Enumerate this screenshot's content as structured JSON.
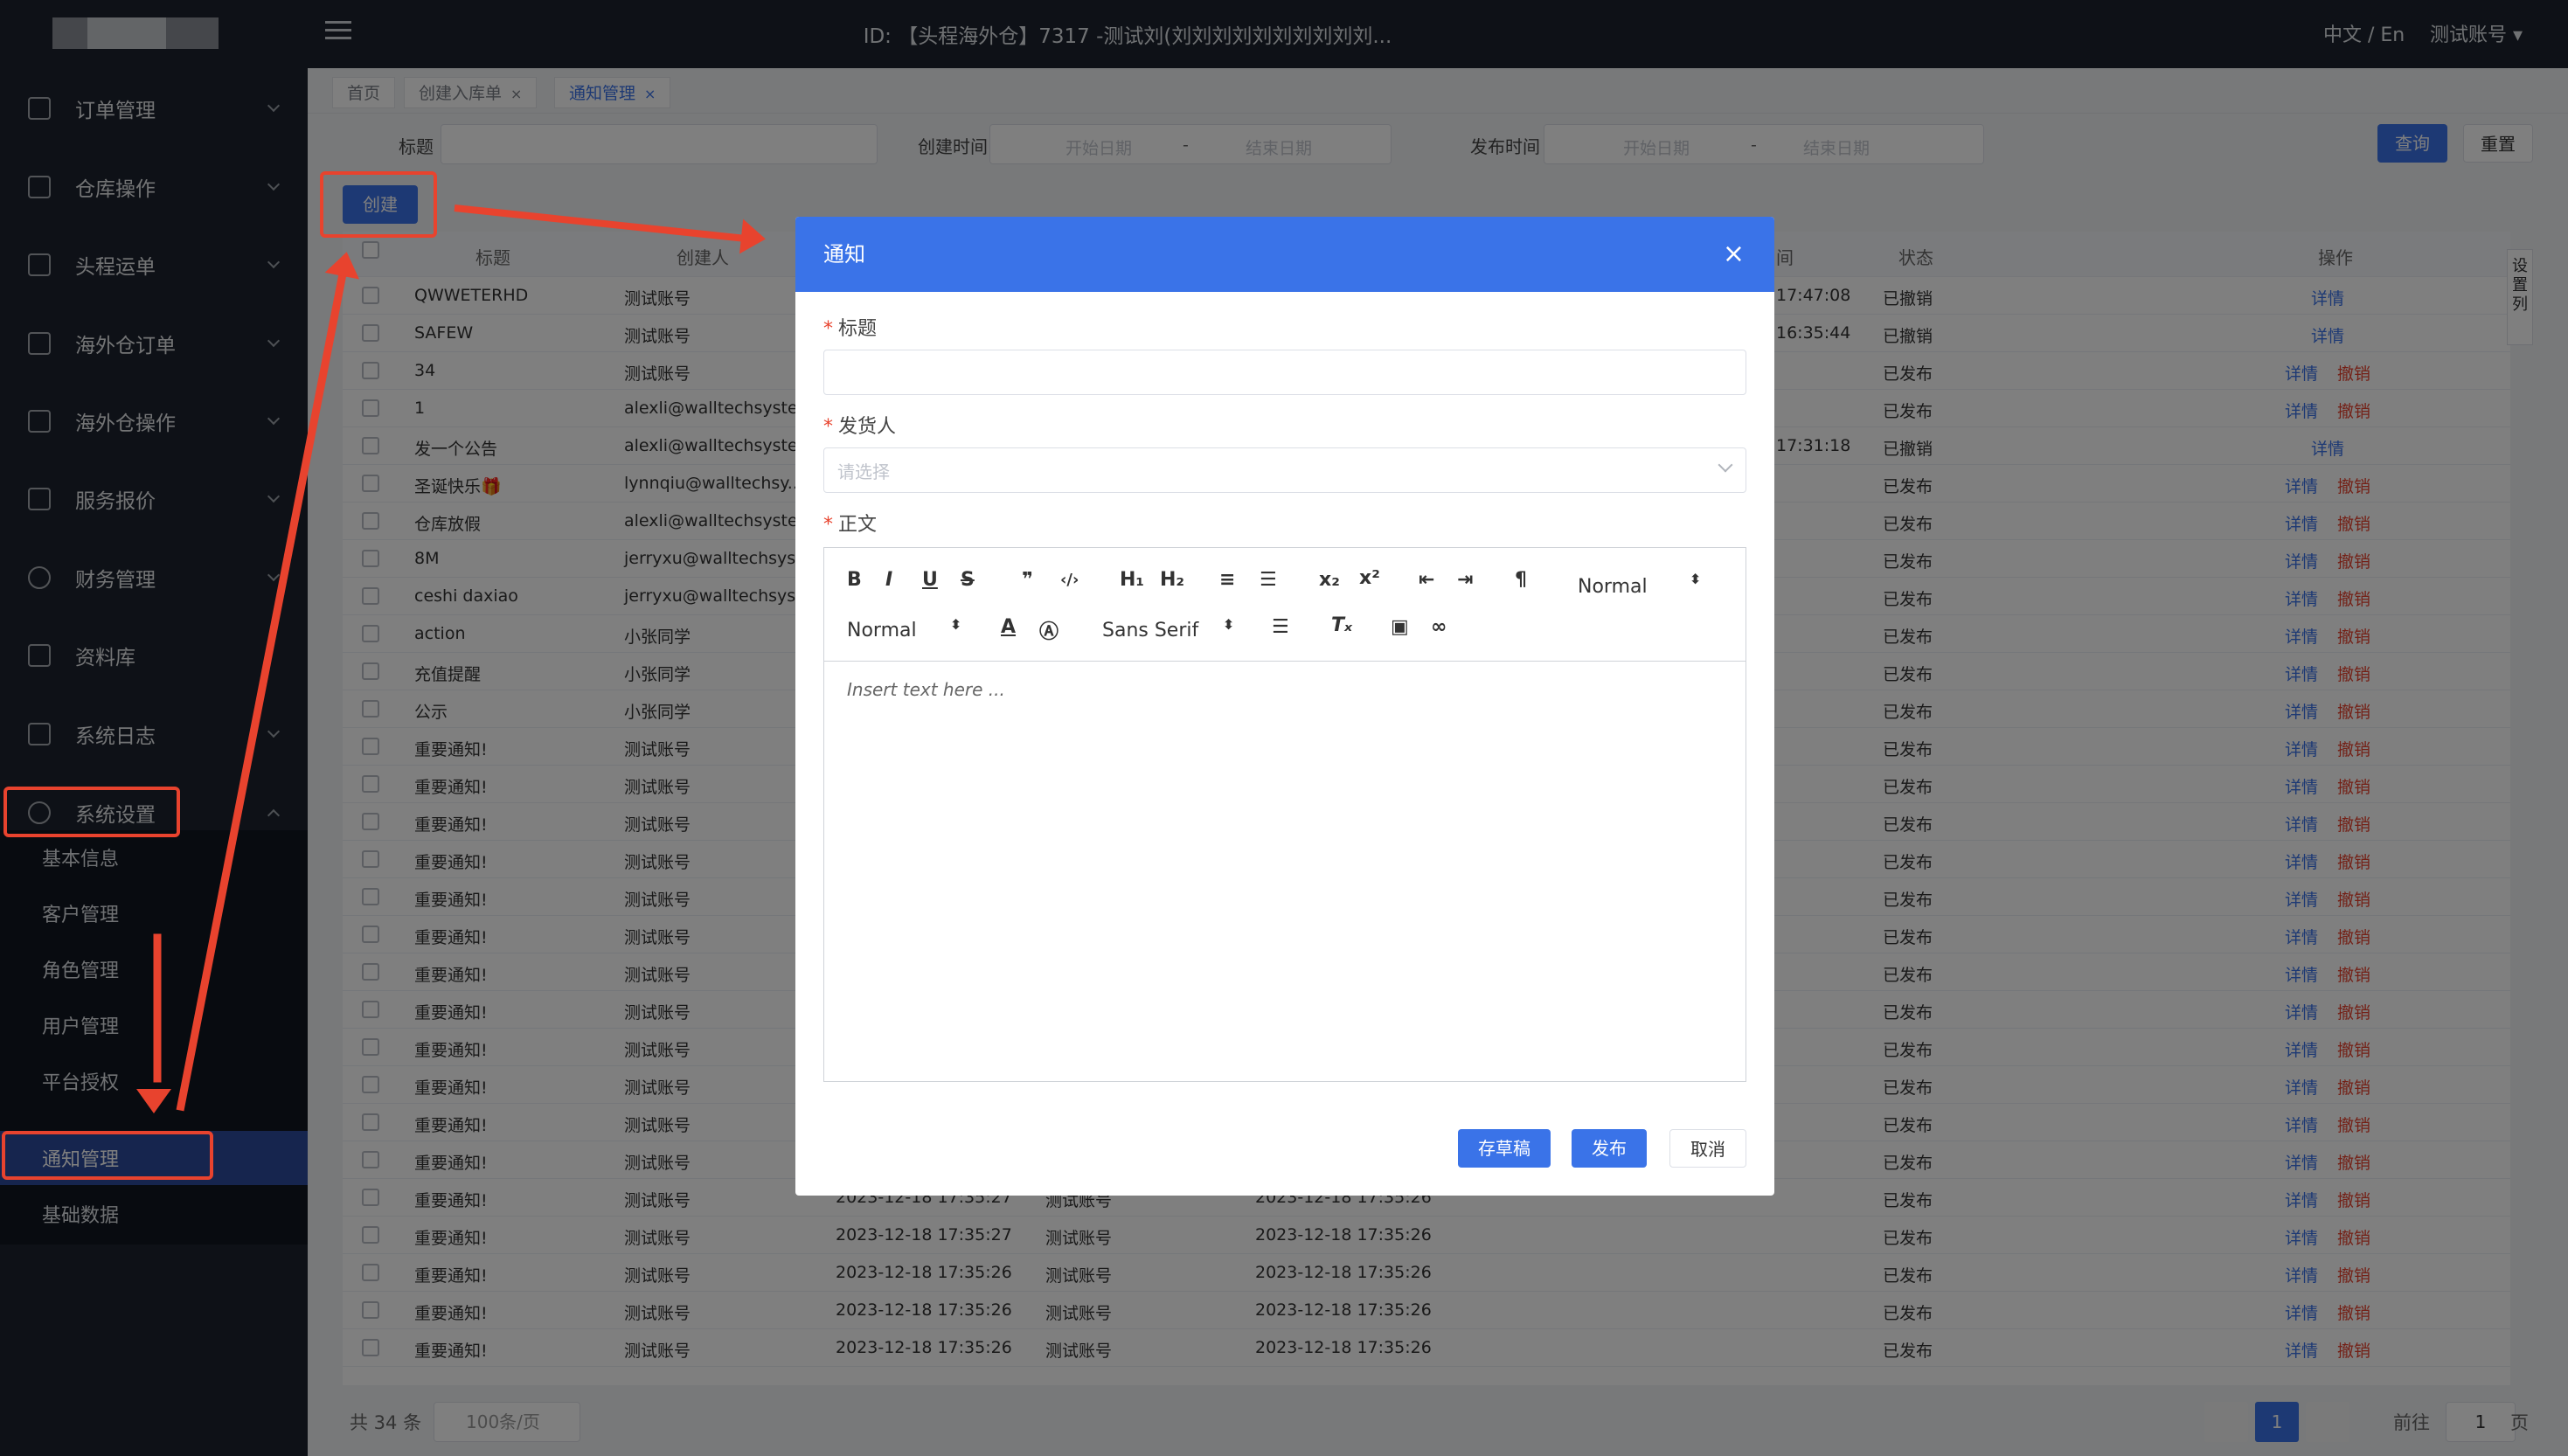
{
  "header": {
    "title": "ID: 【头程海外仓】7317 -测试刘(刘刘刘刘刘刘刘刘刘刘...",
    "lang": "中文 / En",
    "user": "测试账号 ▾"
  },
  "sidebar": {
    "items": [
      {
        "label": "订单管理"
      },
      {
        "label": "仓库操作"
      },
      {
        "label": "头程运单"
      },
      {
        "label": "海外仓订单"
      },
      {
        "label": "海外仓操作"
      },
      {
        "label": "服务报价"
      },
      {
        "label": "财务管理"
      },
      {
        "label": "资料库"
      },
      {
        "label": "系统日志"
      },
      {
        "label": "系统设置"
      }
    ],
    "submenu": [
      {
        "label": "基本信息"
      },
      {
        "label": "客户管理"
      },
      {
        "label": "角色管理"
      },
      {
        "label": "用户管理"
      },
      {
        "label": "平台授权"
      },
      {
        "label": "通知管理"
      },
      {
        "label": "基础数据"
      }
    ]
  },
  "tabs": [
    {
      "label": "首页"
    },
    {
      "label": "创建入库单",
      "close": "×"
    },
    {
      "label": "通知管理",
      "close": "×"
    }
  ],
  "filters": {
    "title_label": "标题",
    "created_label": "创建时间",
    "published_label": "发布时间",
    "start": "开始日期",
    "end": "结束日期",
    "dash": "-",
    "query": "查询",
    "reset": "重置"
  },
  "create_button": "创建",
  "table": {
    "headers": {
      "title": "标题",
      "creator": "创建人",
      "status": "状态",
      "action": "操作",
      "time": "间"
    },
    "rows": [
      {
        "title": "QWWETERHD",
        "creator": "测试账号",
        "pub": "17:47:08",
        "status": "已撤销",
        "a1": "详情",
        "a2": ""
      },
      {
        "title": "SAFEW",
        "creator": "测试账号",
        "pub": "16:35:44",
        "status": "已撤销",
        "a1": "详情",
        "a2": ""
      },
      {
        "title": "34",
        "creator": "测试账号",
        "pub": "",
        "status": "已发布",
        "a1": "详情",
        "a2": "撤销"
      },
      {
        "title": "1",
        "creator": "alexli@walltechsyste...",
        "pub": "",
        "status": "已发布",
        "a1": "详情",
        "a2": "撤销"
      },
      {
        "title": "发一个公告",
        "creator": "alexli@walltechsyste...",
        "pub": "17:31:18",
        "status": "已撤销",
        "a1": "详情",
        "a2": ""
      },
      {
        "title": "圣诞快乐🎁",
        "creator": "lynnqiu@walltechsy...",
        "pub": "",
        "status": "已发布",
        "a1": "详情",
        "a2": "撤销"
      },
      {
        "title": "仓库放假",
        "creator": "alexli@walltechsyste...",
        "pub": "",
        "status": "已发布",
        "a1": "详情",
        "a2": "撤销"
      },
      {
        "title": "8M",
        "creator": "jerryxu@walltechsys...",
        "pub": "",
        "status": "已发布",
        "a1": "详情",
        "a2": "撤销"
      },
      {
        "title": "ceshi daxiao",
        "creator": "jerryxu@walltechsys...",
        "pub": "",
        "status": "已发布",
        "a1": "详情",
        "a2": "撤销"
      },
      {
        "title": "action",
        "creator": "小张同学",
        "pub": "",
        "status": "已发布",
        "a1": "详情",
        "a2": "撤销"
      },
      {
        "title": "充值提醒",
        "creator": "小张同学",
        "pub": "",
        "status": "已发布",
        "a1": "详情",
        "a2": "撤销"
      },
      {
        "title": "公示",
        "creator": "小张同学",
        "pub": "",
        "status": "已发布",
        "a1": "详情",
        "a2": "撤销"
      },
      {
        "title": "重要通知!",
        "creator": "测试账号",
        "pub": "",
        "status": "已发布",
        "a1": "详情",
        "a2": "撤销"
      },
      {
        "title": "重要通知!",
        "creator": "测试账号",
        "pub": "",
        "status": "已发布",
        "a1": "详情",
        "a2": "撤销"
      },
      {
        "title": "重要通知!",
        "creator": "测试账号",
        "pub": "",
        "status": "已发布",
        "a1": "详情",
        "a2": "撤销"
      },
      {
        "title": "重要通知!",
        "creator": "测试账号",
        "pub": "",
        "status": "已发布",
        "a1": "详情",
        "a2": "撤销"
      },
      {
        "title": "重要通知!",
        "creator": "测试账号",
        "pub": "",
        "status": "已发布",
        "a1": "详情",
        "a2": "撤销"
      },
      {
        "title": "重要通知!",
        "creator": "测试账号",
        "pub": "",
        "status": "已发布",
        "a1": "详情",
        "a2": "撤销"
      },
      {
        "title": "重要通知!",
        "creator": "测试账号",
        "pub": "",
        "status": "已发布",
        "a1": "详情",
        "a2": "撤销"
      },
      {
        "title": "重要通知!",
        "creator": "测试账号",
        "pub": "",
        "status": "已发布",
        "a1": "详情",
        "a2": "撤销"
      },
      {
        "title": "重要通知!",
        "creator": "测试账号",
        "pub": "",
        "status": "已发布",
        "a1": "详情",
        "a2": "撤销"
      },
      {
        "title": "重要通知!",
        "creator": "测试账号",
        "pub": "",
        "status": "已发布",
        "a1": "详情",
        "a2": "撤销"
      },
      {
        "title": "重要通知!",
        "creator": "测试账号",
        "pub": "",
        "status": "已发布",
        "a1": "详情",
        "a2": "撤销"
      },
      {
        "title": "重要通知!",
        "creator": "测试账号",
        "pub": "",
        "status": "已发布",
        "a1": "详情",
        "a2": "撤销"
      },
      {
        "title": "重要通知!",
        "creator": "测试账号",
        "created": "2023-12-18 17:35:27",
        "creator2": "测试账号",
        "published": "2023-12-18 17:35:26",
        "pub": "",
        "status": "已发布",
        "a1": "详情",
        "a2": "撤销"
      },
      {
        "title": "重要通知!",
        "creator": "测试账号",
        "created": "2023-12-18 17:35:27",
        "creator2": "测试账号",
        "published": "2023-12-18 17:35:26",
        "pub": "",
        "status": "已发布",
        "a1": "详情",
        "a2": "撤销"
      },
      {
        "title": "重要通知!",
        "creator": "测试账号",
        "created": "2023-12-18 17:35:26",
        "creator2": "测试账号",
        "published": "2023-12-18 17:35:26",
        "pub": "",
        "status": "已发布",
        "a1": "详情",
        "a2": "撤销"
      },
      {
        "title": "重要通知!",
        "creator": "测试账号",
        "created": "2023-12-18 17:35:26",
        "creator2": "测试账号",
        "published": "2023-12-18 17:35:26",
        "pub": "",
        "status": "已发布",
        "a1": "详情",
        "a2": "撤销"
      },
      {
        "title": "重要通知!",
        "creator": "测试账号",
        "created": "2023-12-18 17:35:26",
        "creator2": "测试账号",
        "published": "2023-12-18 17:35:26",
        "pub": "",
        "status": "已发布",
        "a1": "详情",
        "a2": "撤销"
      }
    ],
    "column_settings": "设置列"
  },
  "footer": {
    "total": "共 34 条",
    "page_size": "100条/页",
    "page": "1",
    "goto_prefix": "前往",
    "goto_value": "1",
    "goto_suffix": "页"
  },
  "modal": {
    "title": "通知",
    "close": "×",
    "field_title": "标题",
    "field_sender": "发货人",
    "sender_placeholder": "请选择",
    "field_body": "正文",
    "required": "*",
    "toolbar": {
      "normal1": "Normal",
      "normal2": "Normal",
      "font": "Sans Serif"
    },
    "editor_placeholder": "Insert text here ...",
    "save_draft": "存草稿",
    "publish": "发布",
    "cancel": "取消"
  },
  "colors": {
    "accent": "#3a73e8",
    "sidebar": "#1c232e",
    "annotation": "#e8432e"
  }
}
